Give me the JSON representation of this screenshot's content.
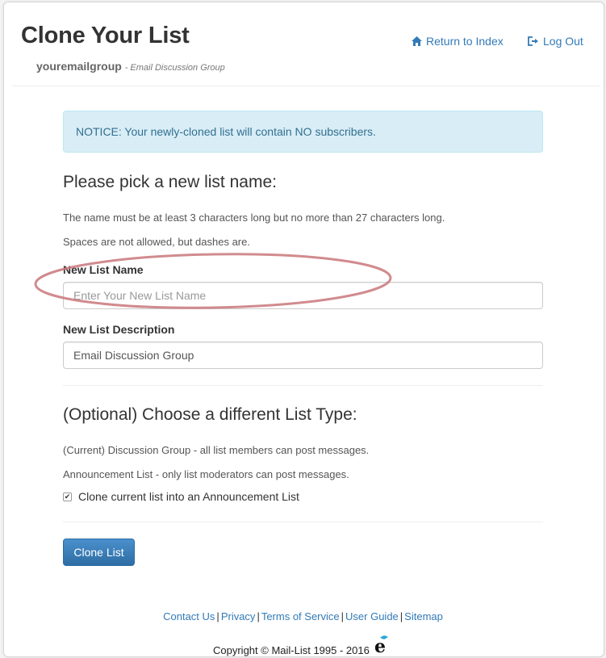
{
  "header": {
    "title": "Clone Your List",
    "group_name": "youremailgroup",
    "group_desc": "- Email Discussion Group",
    "nav_index": "Return to Index",
    "nav_logout": "Log Out"
  },
  "notice": "NOTICE: Your newly-cloned list will contain NO subscribers.",
  "section_name": {
    "heading": "Please pick a new list name:",
    "rule1": "The name must be at least 3 characters long but no more than 27 characters long.",
    "rule2": "Spaces are not allowed, but dashes are."
  },
  "fields": {
    "name_label": "New List Name",
    "name_placeholder": "Enter Your New List Name",
    "desc_label": "New List Description",
    "desc_value": "Email Discussion Group"
  },
  "section_type": {
    "heading": "(Optional) Choose a different List Type:",
    "current": "(Current) Discussion Group - all list members can post messages.",
    "announcement": "Announcement List - only list moderators can post messages.",
    "checkbox_label": "Clone current list into an Announcement List",
    "checkbox_checked": true
  },
  "submit_label": "Clone List",
  "footer": {
    "links": [
      "Contact Us",
      "Privacy",
      "Terms of Service",
      "User Guide",
      "Sitemap"
    ],
    "copyright": "Copyright © Mail-List 1995 - 2016"
  },
  "colors": {
    "link": "#337ab7",
    "notice_bg": "#d9edf7",
    "button": "#3a80bf",
    "annotation": "#c9777a"
  },
  "icons": {
    "nav_index": "home-icon",
    "nav_logout": "logout-icon",
    "footer_logo": "e-logo-icon"
  }
}
